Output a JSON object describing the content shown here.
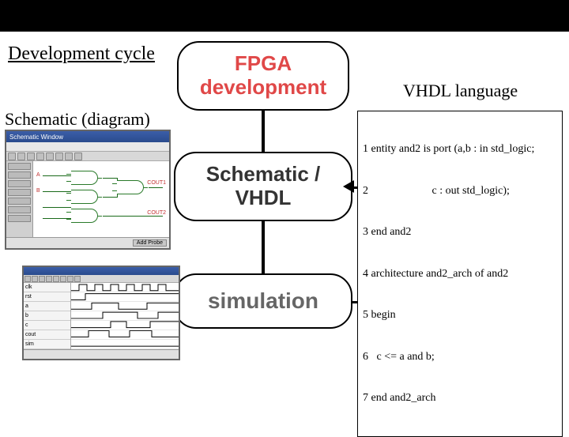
{
  "headings": {
    "dev_cycle": "Development cycle",
    "schematic_diagram": "Schematic (diagram)",
    "vhdl_language": "VHDL language"
  },
  "bubbles": {
    "fpga_dev_line1": "FPGA",
    "fpga_dev_line2": "development",
    "schematic_vhdl_line1": "Schematic /",
    "schematic_vhdl_line2": "VHDL",
    "simulation": "simulation"
  },
  "vhdl_code_lines": [
    "1 entity and2 is port (a,b : in std_logic;",
    "2                       c : out std_logic);",
    "3 end and2",
    "4 architecture and2_arch of and2",
    "5 begin",
    "6   c <= a and b;",
    "7 end and2_arch"
  ],
  "schematic_window": {
    "title": "Schematic Window",
    "canvas_labels": {
      "a": "A",
      "b": "B",
      "cout1": "COUT1",
      "cout2": "COUT2"
    },
    "status_button": "Add Probe"
  },
  "sim_window": {
    "signal_rows": [
      "clk",
      "rst",
      "a",
      "b",
      "c",
      "cout",
      "sim"
    ]
  },
  "colors": {
    "bubble_text_top": "#e04848",
    "bubble_text_mid": "#333333",
    "bubble_text_sim": "#666666"
  }
}
